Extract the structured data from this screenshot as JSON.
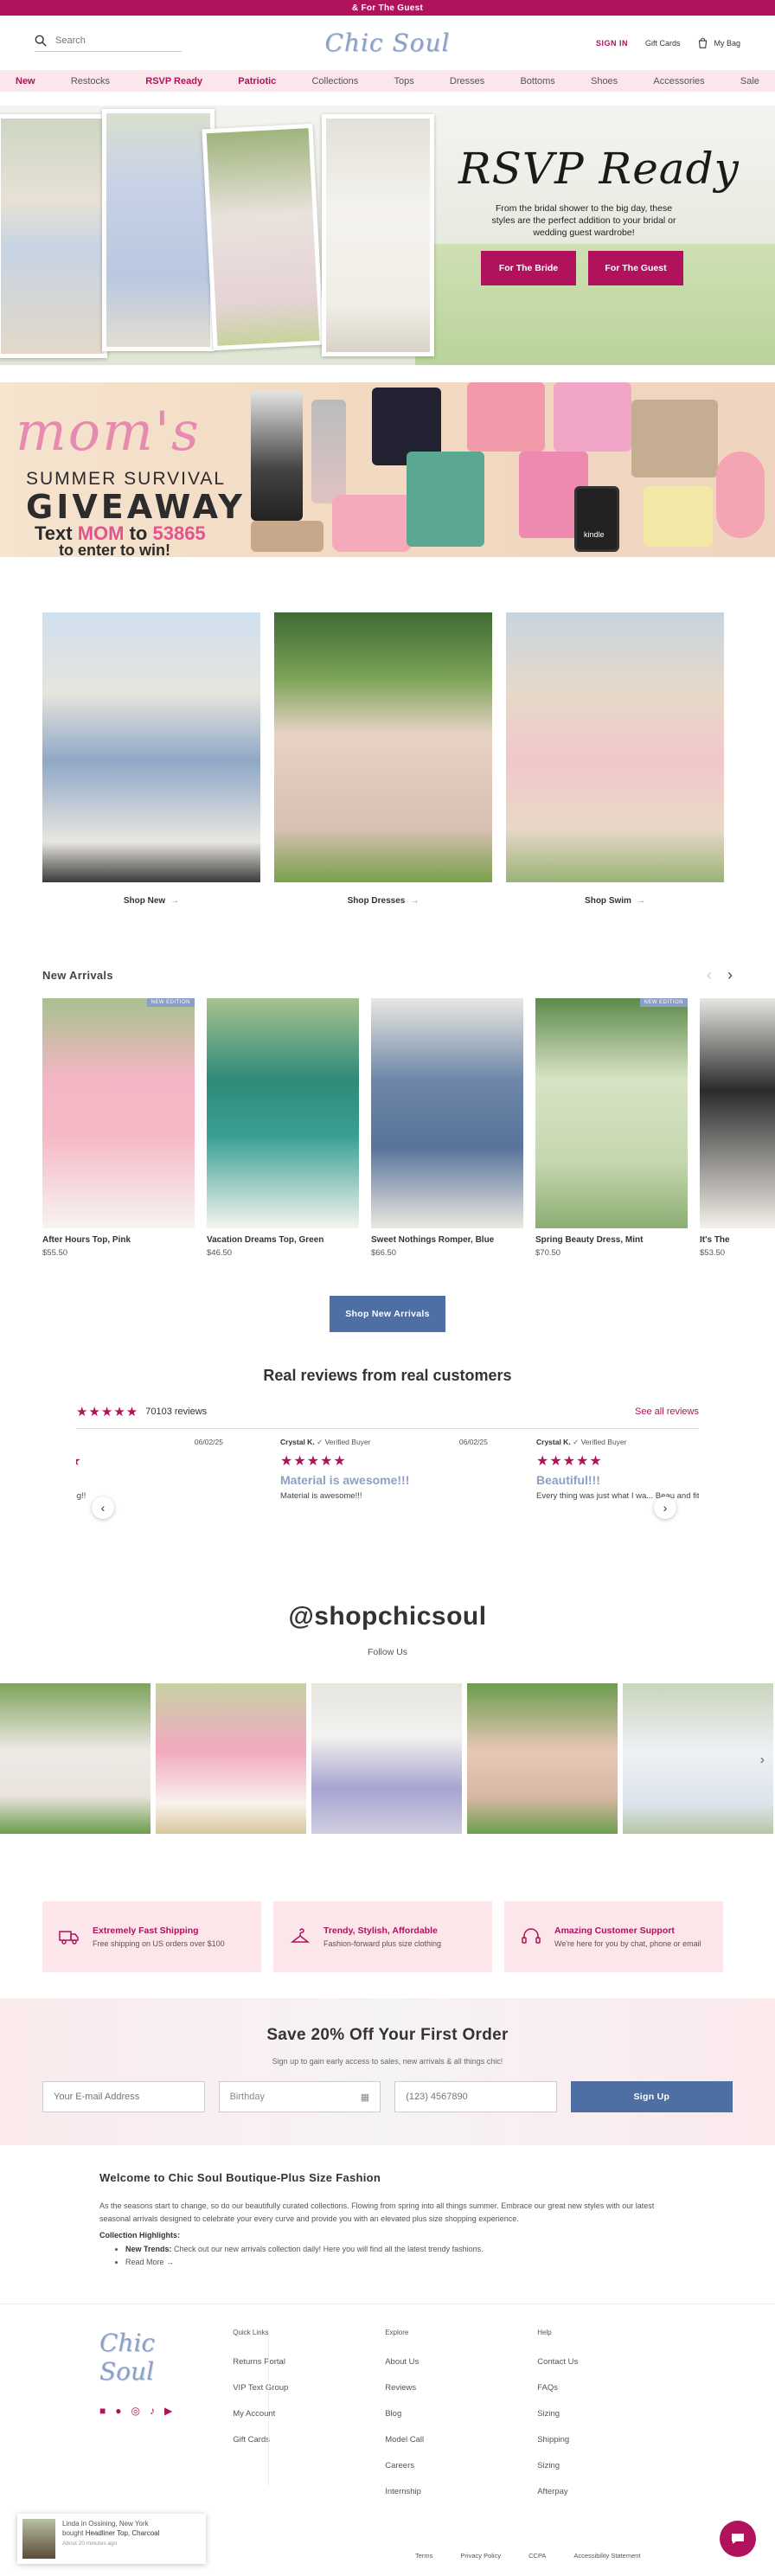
{
  "announcement": "& For The Guest",
  "header": {
    "search_placeholder": "Search",
    "logo": "Chic Soul",
    "sign_in": "SIGN IN",
    "gift_cards": "Gift Cards",
    "bag": "My Bag"
  },
  "nav": [
    {
      "label": "New",
      "highlight": true
    },
    {
      "label": "Restocks",
      "highlight": false
    },
    {
      "label": "RSVP Ready",
      "highlight": true
    },
    {
      "label": "Patriotic",
      "highlight": true
    },
    {
      "label": "Collections",
      "highlight": false
    },
    {
      "label": "Tops",
      "highlight": false
    },
    {
      "label": "Dresses",
      "highlight": false
    },
    {
      "label": "Bottoms",
      "highlight": false
    },
    {
      "label": "Shoes",
      "highlight": false
    },
    {
      "label": "Accessories",
      "highlight": false
    },
    {
      "label": "Sale",
      "highlight": false
    }
  ],
  "hero": {
    "title": "RSVP Ready",
    "text": "From the bridal shower to the big day, these styles are the perfect addition to your bridal or wedding guest wardrobe!",
    "btn_bride": "For The Bride",
    "btn_guest": "For The Guest"
  },
  "giveaway": {
    "moms": "mom's",
    "summer": "SUMMER SURVIVAL",
    "giveaway": "GIVEAWAY",
    "text_pre": "Text ",
    "text_mom": "MOM",
    "text_to": " to ",
    "text_num": "53865",
    "enter": "to enter to win!",
    "kindle": "kindle"
  },
  "categories": [
    {
      "label": "Shop New"
    },
    {
      "label": "Shop Dresses"
    },
    {
      "label": "Shop Swim"
    }
  ],
  "new_arrivals": {
    "title": "New Arrivals",
    "button": "Shop New Arrivals",
    "badge": "NEW EDITION",
    "products": [
      {
        "name": "After Hours Top, Pink",
        "price": "$55.50"
      },
      {
        "name": "Vacation Dreams Top, Green",
        "price": "$46.50"
      },
      {
        "name": "Sweet Nothings Romper, Blue",
        "price": "$66.50"
      },
      {
        "name": "Spring Beauty Dress, Mint",
        "price": "$70.50"
      },
      {
        "name": "It's The",
        "price": "$53.50"
      }
    ]
  },
  "reviews": {
    "title": "Real reviews from real customers",
    "count": "70103 reviews",
    "see_all": "See all reviews",
    "verified": "Verified Buyer",
    "items": [
      {
        "author": "",
        "date": "06/02/25",
        "title": "I",
        "body": "bsolutely stunning!!"
      },
      {
        "author": "Crystal K.",
        "date": "06/02/25",
        "title": "Material is awesome!!!",
        "body": "Material is awesome!!!"
      },
      {
        "author": "Crystal K.",
        "date": "",
        "title": "Beautiful!!!",
        "body": "Every thing was just what I wa... Beau and fits perfectly."
      }
    ]
  },
  "instagram": {
    "handle": "@shopchicsoul",
    "follow": "Follow Us"
  },
  "features": [
    {
      "title": "Extremely Fast Shipping",
      "desc": "Free shipping on US orders over $100"
    },
    {
      "title": "Trendy, Stylish, Affordable",
      "desc": "Fashion-forward plus size clothing"
    },
    {
      "title": "Amazing Customer Support",
      "desc": "We're here for you by chat, phone or email"
    }
  ],
  "signup": {
    "title": "Save 20% Off Your First Order",
    "sub": "Sign up to gain early access to sales, new arrivals & all things chic!",
    "email_placeholder": "Your E-mail Address",
    "birthday_placeholder": "Birthday",
    "phone_placeholder": "(123) 4567890",
    "button": "Sign Up"
  },
  "seo": {
    "title": "Welcome to Chic Soul Boutique-Plus Size Fashion",
    "body": "As the seasons start to change, so do our beautifully curated collections. Flowing from spring into all things summer. Embrace our great new styles with our latest seasonal arrivals designed to celebrate your every curve and provide you with an elevated plus size shopping experience.",
    "highlights": "Collection Highlights:",
    "item_label": "New Trends:",
    "item_text": " Check out our new arrivals collection daily! Here you will find all the latest trendy fashions.",
    "read_more": "Read More"
  },
  "footer": {
    "logo": "Chic Soul",
    "quick_links": {
      "title": "Quick Links",
      "items": [
        "Returns Portal",
        "VIP Text Group",
        "My Account",
        "Gift Cards"
      ]
    },
    "explore": {
      "title": "Explore",
      "items": [
        "About Us",
        "Reviews",
        "Blog",
        "Model Call",
        "Careers",
        "Internship"
      ]
    },
    "help": {
      "title": "Help",
      "items": [
        "Contact Us",
        "FAQs",
        "Sizing",
        "Shipping",
        "Sizing",
        "Afterpay"
      ]
    },
    "legal": [
      "Terms",
      "Privacy Policy",
      "CCPA",
      "Accessibility Statement"
    ]
  },
  "toast": {
    "line1": "Linda in Ossining, New York",
    "line2": "bought",
    "product": "Headliner Top, Charcoal",
    "time": "About 20 minutes ago"
  },
  "colors": {
    "brand_pink": "#b0125b",
    "brand_blue": "#4e6fa3",
    "logo_blue": "#8c9fc5"
  }
}
